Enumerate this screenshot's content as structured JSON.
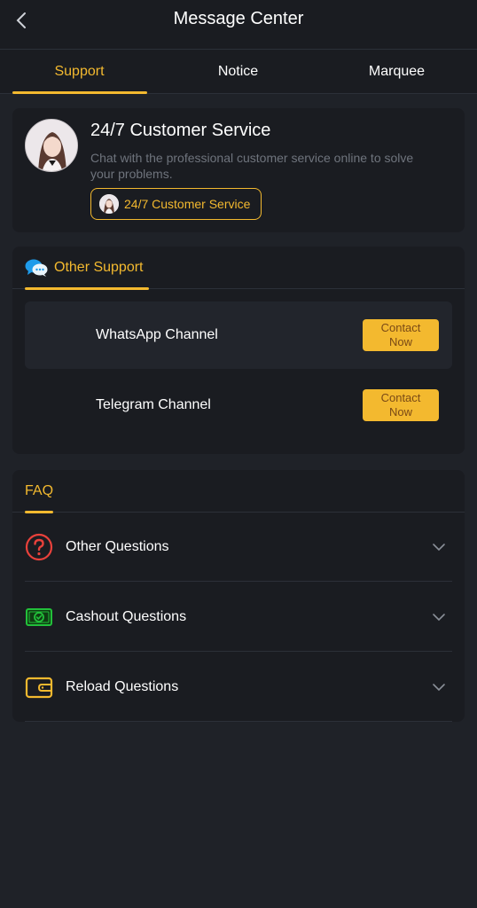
{
  "header": {
    "title": "Message Center"
  },
  "tabs": [
    {
      "label": "Support",
      "active": true
    },
    {
      "label": "Notice",
      "active": false
    },
    {
      "label": "Marquee",
      "active": false
    }
  ],
  "customer_service": {
    "title": "24/7 Customer Service",
    "description": "Chat with the professional customer service online to solve your problems.",
    "button_label": "24/7 Customer Service"
  },
  "other_support": {
    "label": "Other Support",
    "channels": [
      {
        "name": "WhatsApp Channel",
        "button": "Contact Now"
      },
      {
        "name": "Telegram Channel",
        "button": "Contact Now"
      }
    ]
  },
  "faq": {
    "label": "FAQ",
    "items": [
      {
        "label": "Other Questions",
        "icon": "question-icon"
      },
      {
        "label": "Cashout Questions",
        "icon": "cash-icon"
      },
      {
        "label": "Reload Questions",
        "icon": "wallet-icon"
      }
    ]
  },
  "colors": {
    "accent": "#f3b92f",
    "background": "#1f2228",
    "card": "#1a1c21"
  }
}
